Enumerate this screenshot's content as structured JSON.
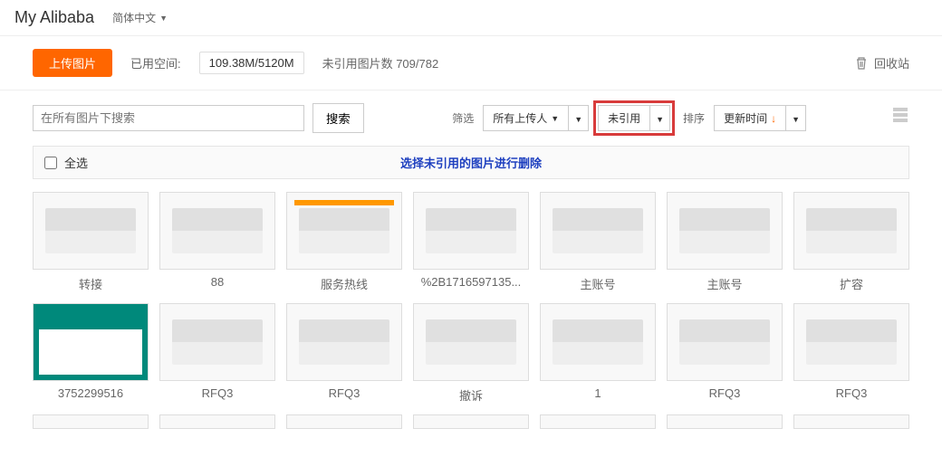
{
  "header": {
    "logo": "My Alibaba",
    "lang": "简体中文"
  },
  "toolbar": {
    "upload": "上传图片",
    "used_label": "已用空间:",
    "used_value": "109.38M/5120M",
    "unused_label": "未引用图片数 709/782",
    "trash": "回收站"
  },
  "filters": {
    "search_placeholder": "在所有图片下搜索",
    "search_btn": "搜索",
    "filter_label": "筛选",
    "uploader": "所有上传人",
    "status": "未引用",
    "sort_label": "排序",
    "sort_value": "更新时间"
  },
  "selectall": {
    "label": "全选",
    "instruction": "选择未引用的图片进行删除"
  },
  "items": [
    {
      "name": "转接"
    },
    {
      "name": "88"
    },
    {
      "name": "服务热线"
    },
    {
      "name": "%2B1716597135..."
    },
    {
      "name": "主账号"
    },
    {
      "name": "主账号"
    },
    {
      "name": "扩容"
    },
    {
      "name": "3752299516"
    },
    {
      "name": "RFQ3"
    },
    {
      "name": "RFQ3"
    },
    {
      "name": "撤诉"
    },
    {
      "name": "1"
    },
    {
      "name": "RFQ3"
    },
    {
      "name": "RFQ3"
    }
  ]
}
